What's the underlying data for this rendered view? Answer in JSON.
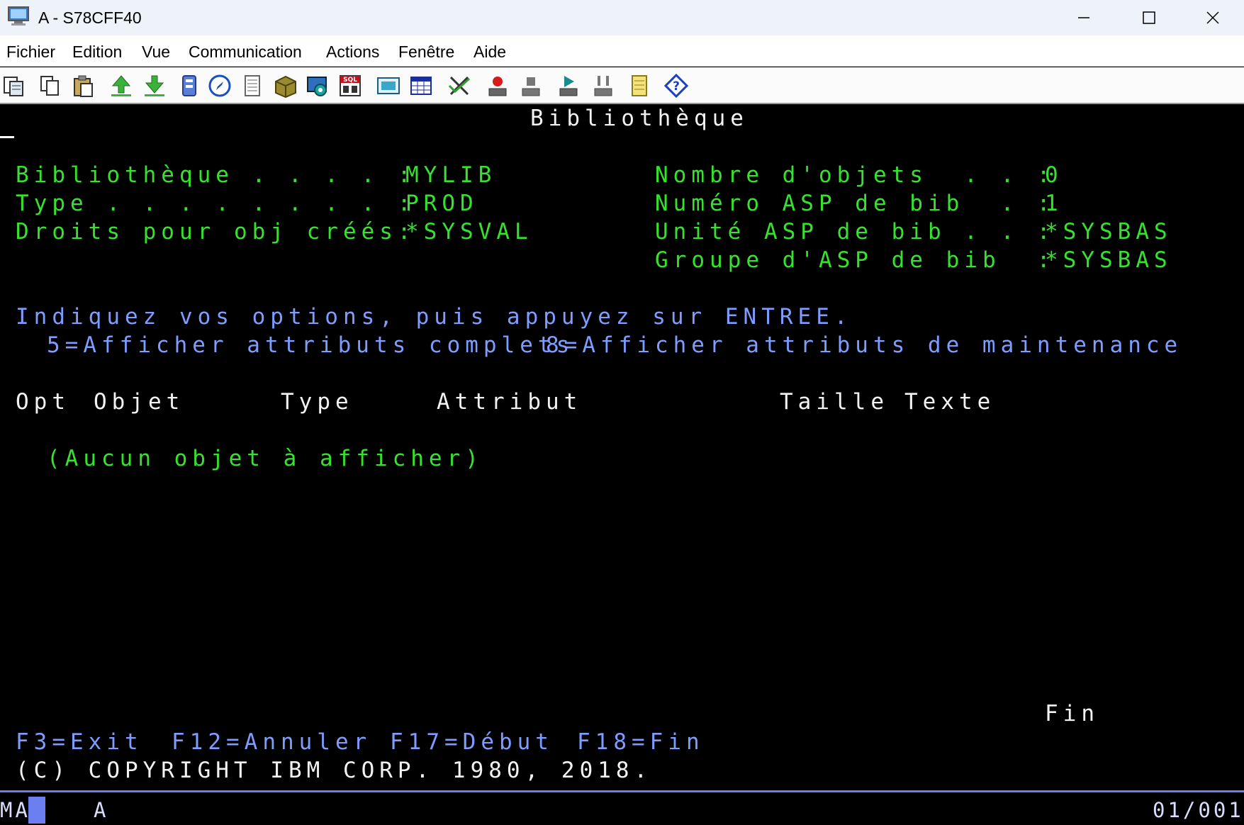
{
  "window": {
    "title": "A - S78CFF40"
  },
  "menu": [
    "Fichier",
    "Edition",
    "Vue",
    "Communication",
    "Actions",
    "Fenêtre",
    "Aide"
  ],
  "toolbar_icons": [
    "copy-screen-icon",
    "copy-icon",
    "paste-icon",
    "send-file-icon",
    "receive-file-icon",
    "file-transfer-icon",
    "compass-icon",
    "document-icon",
    "package-icon",
    "settings-icon",
    "sql-icon",
    "display-icon",
    "grid-icon",
    "macro-icon",
    "record-macro-icon",
    "stop-icon",
    "play-macro-icon",
    "keypad-icon",
    "notes-icon",
    "help-icon"
  ],
  "screen": {
    "title": "Bibliothèque",
    "fields_left": [
      {
        "label": "Bibliothèque . . . . :",
        "value": "MYLIB"
      },
      {
        "label": "Type . . . . . . . . :",
        "value": "PROD"
      },
      {
        "label": "Droits pour obj créés:",
        "value": "*SYSVAL"
      }
    ],
    "fields_right": [
      {
        "label": "Nombre d'objets  . . :",
        "value": "0"
      },
      {
        "label": "Numéro ASP de bib  . :",
        "value": "1"
      },
      {
        "label": "Unité ASP de bib . . :",
        "value": "*SYSBAS"
      },
      {
        "label": "Groupe d'ASP de bib  :",
        "value": "*SYSBAS"
      }
    ],
    "instruction": "Indiquez vos options, puis appuyez sur ENTREE.",
    "options": [
      "5=Afficher attributs complets",
      "8=Afficher attributs de maintenance"
    ],
    "columns": [
      "Opt",
      "Objet",
      "Type",
      "Attribut",
      "Taille",
      "Texte"
    ],
    "empty_message": "(Aucun objet à afficher)",
    "more_indicator": "Fin",
    "function_keys": [
      "F3=Exit",
      "F12=Annuler",
      "F17=Début",
      "F18=Fin"
    ],
    "copyright": "(C) COPYRIGHT IBM CORP. 1980, 2018."
  },
  "status": {
    "mode": "MA",
    "session": "A",
    "position": "01/001"
  },
  "colors": {
    "field_green": "#37e22f",
    "text_blue": "#7f9cff",
    "text_white": "#f2f2f2",
    "status_accent": "#6c7ff0"
  }
}
